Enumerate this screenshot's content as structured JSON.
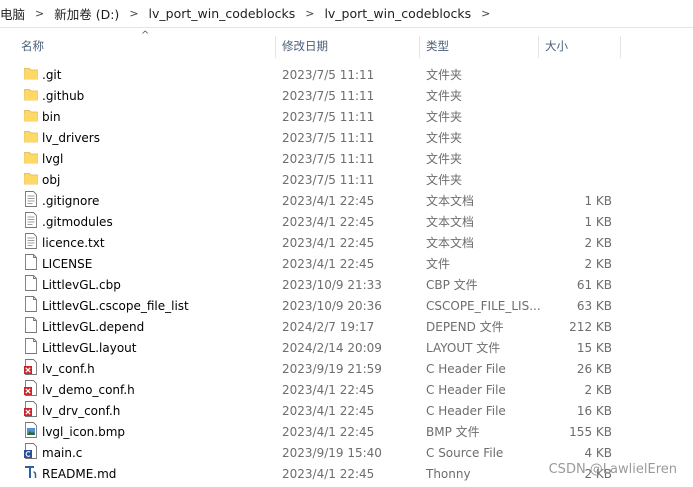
{
  "breadcrumb": [
    "电脑",
    "新加卷 (D:)",
    "lv_port_win_codeblocks",
    "lv_port_win_codeblocks"
  ],
  "columns": {
    "name": "名称",
    "date": "修改日期",
    "type": "类型",
    "size": "大小"
  },
  "files": [
    {
      "name": ".git",
      "date": "2023/7/5 11:11",
      "type": "文件夹",
      "size": "",
      "icon": "folder"
    },
    {
      "name": ".github",
      "date": "2023/7/5 11:11",
      "type": "文件夹",
      "size": "",
      "icon": "folder"
    },
    {
      "name": "bin",
      "date": "2023/7/5 11:11",
      "type": "文件夹",
      "size": "",
      "icon": "folder"
    },
    {
      "name": "lv_drivers",
      "date": "2023/7/5 11:11",
      "type": "文件夹",
      "size": "",
      "icon": "folder"
    },
    {
      "name": "lvgl",
      "date": "2023/7/5 11:11",
      "type": "文件夹",
      "size": "",
      "icon": "folder"
    },
    {
      "name": "obj",
      "date": "2023/7/5 11:11",
      "type": "文件夹",
      "size": "",
      "icon": "folder"
    },
    {
      "name": ".gitignore",
      "date": "2023/4/1 22:45",
      "type": "文本文档",
      "size": "1 KB",
      "icon": "text"
    },
    {
      "name": ".gitmodules",
      "date": "2023/4/1 22:45",
      "type": "文本文档",
      "size": "1 KB",
      "icon": "text"
    },
    {
      "name": "licence.txt",
      "date": "2023/4/1 22:45",
      "type": "文本文档",
      "size": "2 KB",
      "icon": "text"
    },
    {
      "name": "LICENSE",
      "date": "2023/4/1 22:45",
      "type": "文件",
      "size": "2 KB",
      "icon": "blank"
    },
    {
      "name": "LittlevGL.cbp",
      "date": "2023/10/9 21:33",
      "type": "CBP 文件",
      "size": "61 KB",
      "icon": "blank"
    },
    {
      "name": "LittlevGL.cscope_file_list",
      "date": "2023/10/9 20:36",
      "type": "CSCOPE_FILE_LIS...",
      "size": "63 KB",
      "icon": "blank"
    },
    {
      "name": "LittlevGL.depend",
      "date": "2024/2/7 19:17",
      "type": "DEPEND 文件",
      "size": "212 KB",
      "icon": "blank"
    },
    {
      "name": "LittlevGL.layout",
      "date": "2024/2/14 20:09",
      "type": "LAYOUT 文件",
      "size": "15 KB",
      "icon": "blank"
    },
    {
      "name": "lv_conf.h",
      "date": "2023/9/19 21:59",
      "type": "C Header File",
      "size": "26 KB",
      "icon": "header"
    },
    {
      "name": "lv_demo_conf.h",
      "date": "2023/4/1 22:45",
      "type": "C Header File",
      "size": "2 KB",
      "icon": "header"
    },
    {
      "name": "lv_drv_conf.h",
      "date": "2023/4/1 22:45",
      "type": "C Header File",
      "size": "16 KB",
      "icon": "header"
    },
    {
      "name": "lvgl_icon.bmp",
      "date": "2023/4/1 22:45",
      "type": "BMP 文件",
      "size": "155 KB",
      "icon": "image"
    },
    {
      "name": "main.c",
      "date": "2023/9/19 15:40",
      "type": "C Source File",
      "size": "4 KB",
      "icon": "csource"
    },
    {
      "name": "README.md",
      "date": "2023/4/1 22:45",
      "type": "Thonny",
      "size": "2 KB",
      "icon": "thonny"
    }
  ],
  "watermark": "CSDN @LawlielEren"
}
